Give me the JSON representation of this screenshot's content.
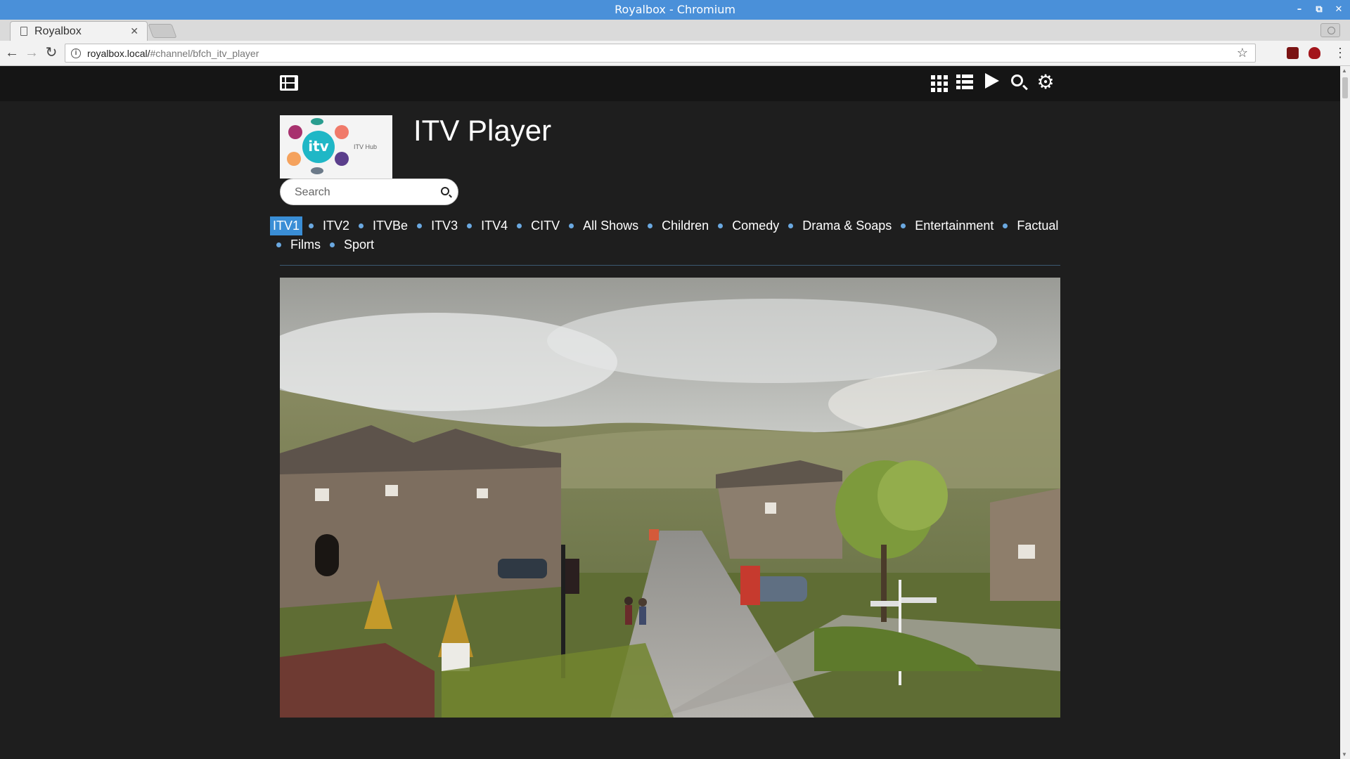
{
  "window": {
    "title": "Royalbox - Chromium"
  },
  "tab": {
    "title": "Royalbox"
  },
  "address_bar": {
    "host": "royalbox.local/",
    "path": "#channel/bfch_itv_player"
  },
  "page": {
    "channel_title": "ITV Player",
    "logo_text": "itv",
    "logo_caption": "ITV Hub",
    "search_placeholder": "Search",
    "categories": [
      "ITV1",
      "ITV2",
      "ITVBe",
      "ITV3",
      "ITV4",
      "CITV",
      "All Shows",
      "Children",
      "Comedy",
      "Drama & Soaps",
      "Entertainment",
      "Factual",
      "Films",
      "Sport"
    ],
    "active_category": "ITV1",
    "accent_color": "#3a8ed6",
    "header_icons": [
      "film-icon",
      "grid-view-icon",
      "list-view-icon",
      "play-icon",
      "search-icon",
      "settings-gear-icon"
    ]
  }
}
